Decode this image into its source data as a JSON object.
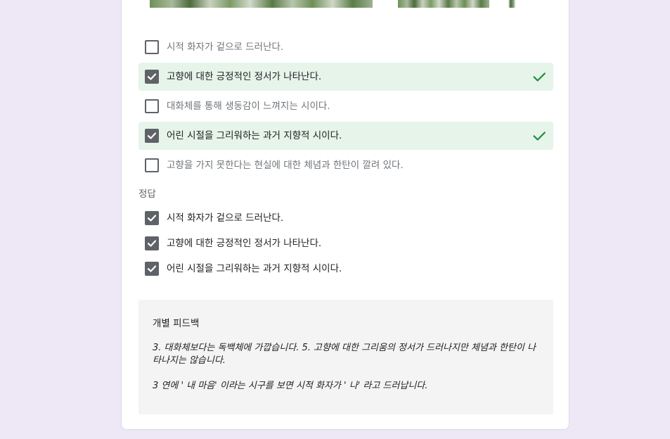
{
  "options": [
    {
      "label": "시적 화자가 겉으로 드러난다.",
      "checked": false,
      "correct": false
    },
    {
      "label": "고향에 대한 긍정적인 정서가 나타난다.",
      "checked": true,
      "correct": true
    },
    {
      "label": "대화체를 통해 생동감이 느껴지는 시이다.",
      "checked": false,
      "correct": false
    },
    {
      "label": "어린 시절을 그리워하는 과거 지향적 시이다.",
      "checked": true,
      "correct": true
    },
    {
      "label": "고향을 가지 못한다는 현실에 대한 체념과 한탄이 깔려 있다.",
      "checked": false,
      "correct": false
    }
  ],
  "answer": {
    "heading": "정답",
    "items": [
      "시적 화자가 겉으로 드러난다.",
      "고향에 대한 긍정적인 정서가 나타난다.",
      "어린 시절을 그리워하는 과거 지향적 시이다."
    ]
  },
  "feedback": {
    "title": "개별 피드백",
    "paragraph1": "3. 대화체보다는 독백체에 가깝습니다. 5. 고향에 대한 그리움의 정서가 드러나지만 체념과 한탄이 나타나지는 않습니다.",
    "paragraph2": "3 연에 ' 내 마음' 이라는 시구를 보면 시적 화자가 ' 나' 라고 드러납니다."
  },
  "colors": {
    "correct_bg": "#e6f4ea",
    "correct_tick": "#1e8e3e",
    "checkbox": "#5f6368",
    "page_bg": "#ede7f6"
  }
}
